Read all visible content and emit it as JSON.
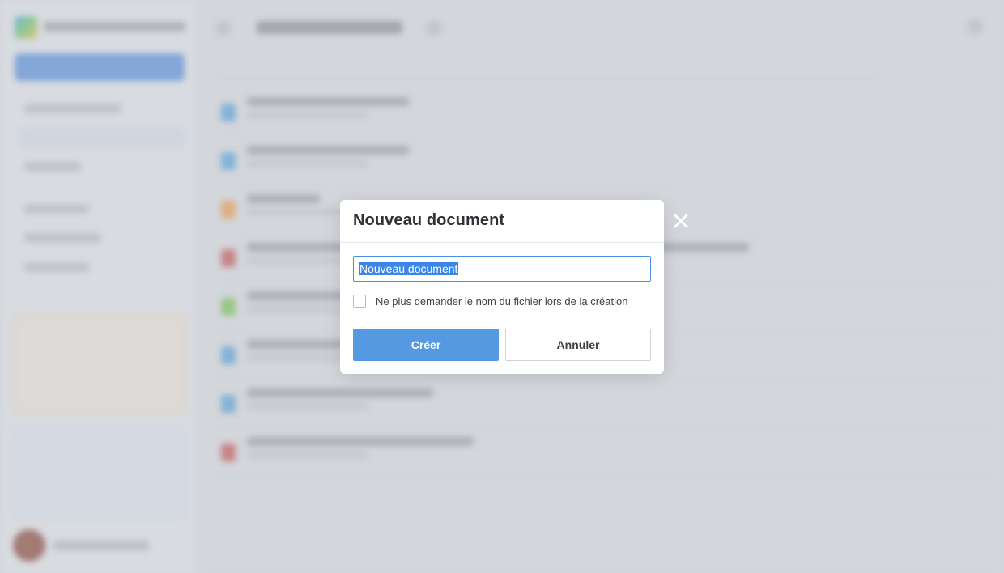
{
  "dialog": {
    "title": "Nouveau document",
    "filename_value": "Nouveau document",
    "checkbox_label": "Ne plus demander le nom du fichier lors de la création",
    "checkbox_checked": false,
    "create_label": "Créer",
    "cancel_label": "Annuler",
    "close_icon": "close-icon"
  },
  "colors": {
    "primary": "#5499e2",
    "selection": "#3b86e6",
    "focus_border": "#4a90e2"
  }
}
